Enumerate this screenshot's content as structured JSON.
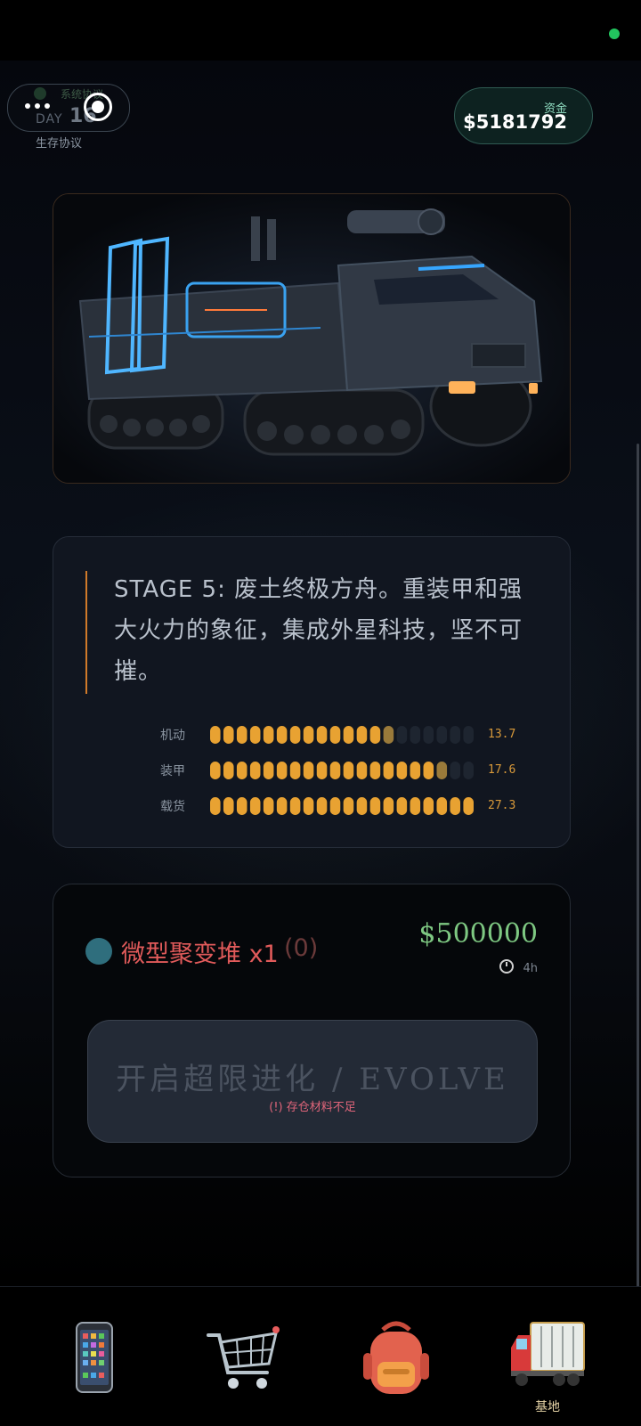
{
  "header": {
    "system_label": "系统协议",
    "day_label": "DAY",
    "day_number": "16",
    "subtitle": "生存协议",
    "funds_label": "资金",
    "funds_value": "$5181792"
  },
  "vehicle": {
    "image_alt": "armored tracked vehicle"
  },
  "info": {
    "description": "STAGE 5: 废土终极方舟。重装甲和强大火力的象征，集成外星科技，坚不可摧。",
    "stats": [
      {
        "label": "机动",
        "value": "13.7",
        "level": 0.68
      },
      {
        "label": "装甲",
        "value": "17.6",
        "level": 0.88
      },
      {
        "label": "载货",
        "value": "27.3",
        "level": 1.0
      }
    ]
  },
  "evolve": {
    "material_name": "微型聚变堆 x1",
    "material_owned": "(0)",
    "price": "$500000",
    "time": "4h",
    "button_label": "开启超限进化 / EVOLVE",
    "warning": "(!) 存仓材料不足"
  },
  "nav": {
    "items": [
      {
        "icon": "phone-icon"
      },
      {
        "icon": "cart-icon"
      },
      {
        "icon": "backpack-icon"
      },
      {
        "icon": "truck-icon",
        "label": "基地"
      }
    ]
  },
  "colors": {
    "accent_orange": "#d99a3a",
    "price_green": "#7ec882",
    "warning_red": "#e05a5a",
    "status_green": "#22c55e"
  }
}
